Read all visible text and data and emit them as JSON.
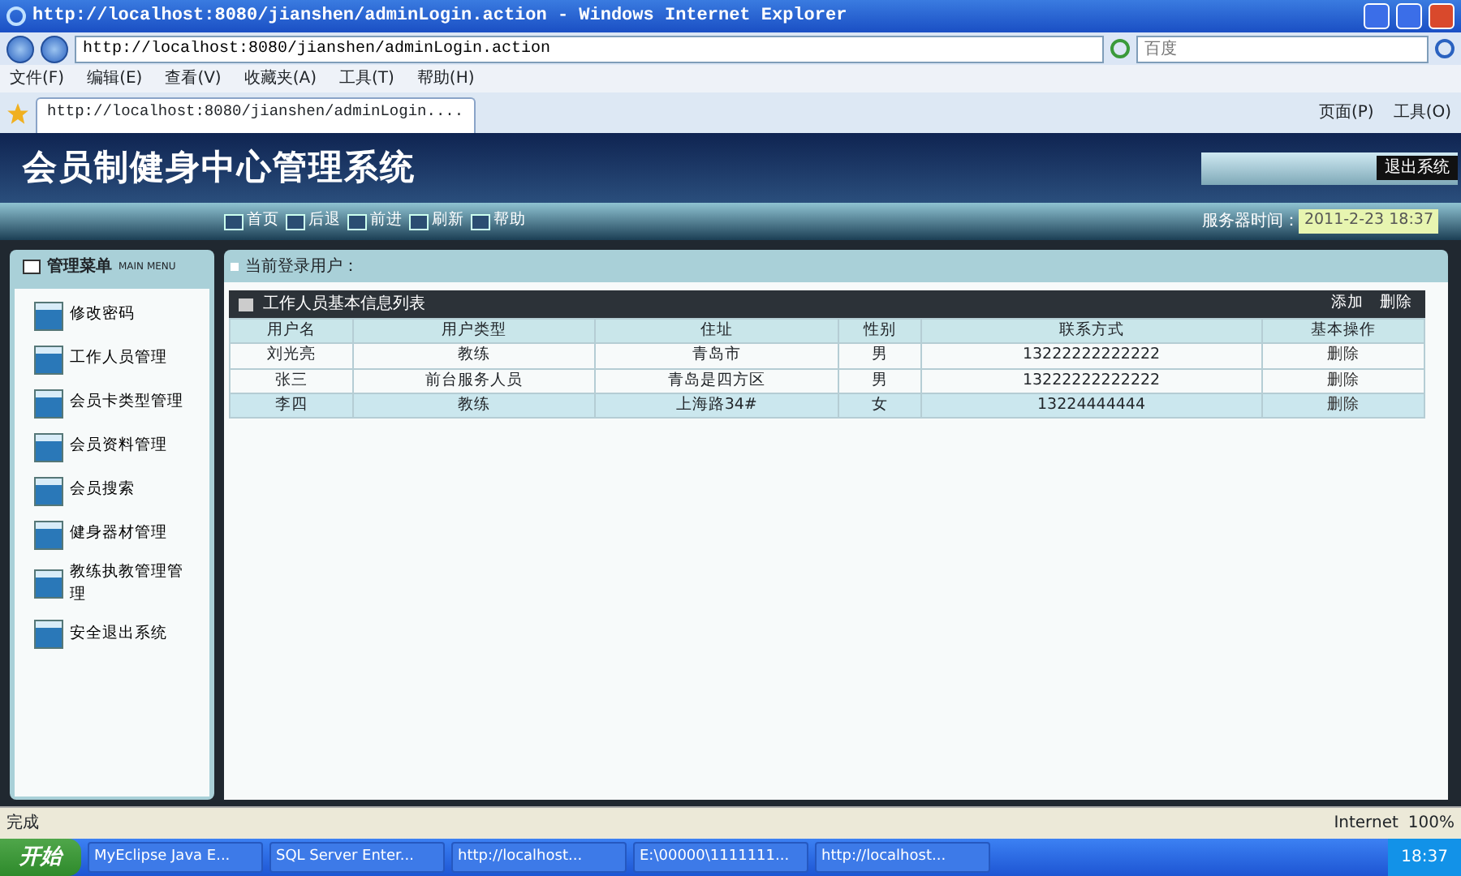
{
  "window": {
    "title": "http://localhost:8080/jianshen/adminLogin.action - Windows Internet Explorer"
  },
  "address_bar": {
    "url": "http://localhost:8080/jianshen/adminLogin.action",
    "search_placeholder": "百度"
  },
  "menu_bar": [
    "文件(F)",
    "编辑(E)",
    "查看(V)",
    "收藏夹(A)",
    "工具(T)",
    "帮助(H)"
  ],
  "browser_tabs": [
    {
      "label": "http://localhost:8080/jianshen/adminLogin....",
      "selected": true
    }
  ],
  "command_bar": [
    "页面(P)",
    "工具(O)"
  ],
  "app": {
    "title": "会员制健身中心管理系统",
    "logout": "退出系统",
    "nav": [
      "首页",
      "后退",
      "前进",
      "刷新",
      "帮助"
    ],
    "server_time_label": "服务器时间：",
    "server_time": "2011-2-23 18:37",
    "sidebar_title": "管理菜单",
    "sidebar_subtitle": "MAIN MENU",
    "current_user_label": "当前登录用户：",
    "sidebar_items": [
      "修改密码",
      "工作人员管理",
      "会员卡类型管理",
      "会员资料管理",
      "会员搜索",
      "健身器材管理",
      "教练执教管理管理",
      "安全退出系统"
    ],
    "table": {
      "title": "工作人员基本信息列表",
      "actions": [
        "添加",
        "删除"
      ],
      "columns": [
        "用户名",
        "用户类型",
        "住址",
        "性别",
        "联系方式",
        "基本操作"
      ],
      "rows": [
        {
          "cells": [
            "刘光亮",
            "教练",
            "青岛市",
            "男",
            "13222222222222",
            "删除"
          ],
          "selected": false
        },
        {
          "cells": [
            "张三",
            "前台服务人员",
            "青岛是四方区",
            "男",
            "13222222222222",
            "删除"
          ],
          "selected": false
        },
        {
          "cells": [
            "李四",
            "教练",
            "上海路34#",
            "女",
            "13224444444",
            "删除"
          ],
          "selected": true
        }
      ]
    }
  },
  "status_bar": {
    "text": "完成",
    "zone": "Internet",
    "zoom": "100%"
  },
  "taskbar": {
    "start": "开始",
    "items": [
      "MyEclipse Java E...",
      "SQL Server Enter...",
      "http://localhost...",
      "E:\\00000\\1111111...",
      "http://localhost..."
    ],
    "clock": "18:37"
  }
}
